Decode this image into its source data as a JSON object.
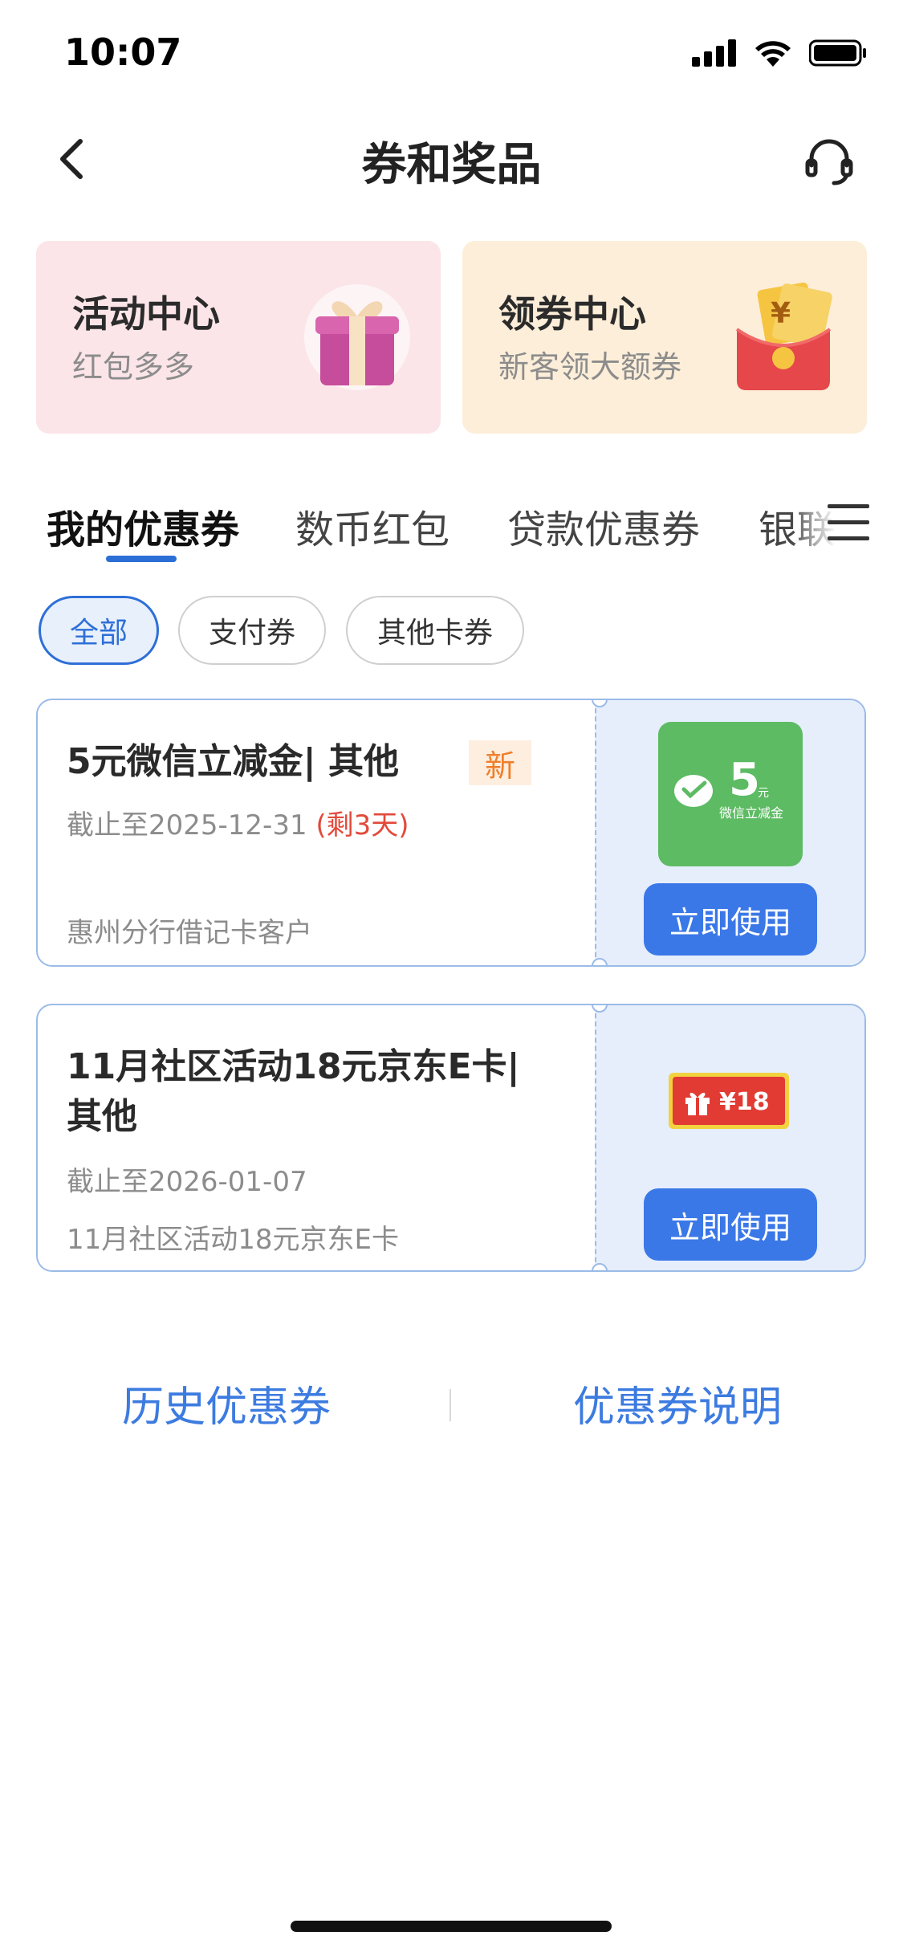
{
  "status_bar": {
    "time": "10:07"
  },
  "nav": {
    "title": "券和奖品"
  },
  "promo_cards": [
    {
      "title": "活动中心",
      "subtitle": "红包多多"
    },
    {
      "title": "领券中心",
      "subtitle": "新客领大额券"
    }
  ],
  "tabs": [
    "我的优惠券",
    "数币红包",
    "贷款优惠券",
    "银联"
  ],
  "filters": [
    "全部",
    "支付券",
    "其他卡券"
  ],
  "coupons": [
    {
      "title": "5元微信立减金| 其他",
      "badge": "新",
      "expiry": "截止至2025-12-31",
      "remaining": "(剩3天)",
      "note": "惠州分行借记卡客户",
      "thumb_value": "5",
      "thumb_unit": "元",
      "thumb_text": "微信立减金",
      "button": "立即使用"
    },
    {
      "title_line1": "11月社区活动18元京东E卡|",
      "title_line2": "其他",
      "expiry": "截止至2026-01-07",
      "note": "11月社区活动18元京东E卡",
      "thumb_value": "¥18",
      "button": "立即使用"
    }
  ],
  "links": {
    "history": "历史优惠券",
    "explain": "优惠券说明"
  },
  "colors": {
    "accent": "#3b78e7",
    "warning": "#e24a3b",
    "new_badge": "#ee7f2a"
  }
}
